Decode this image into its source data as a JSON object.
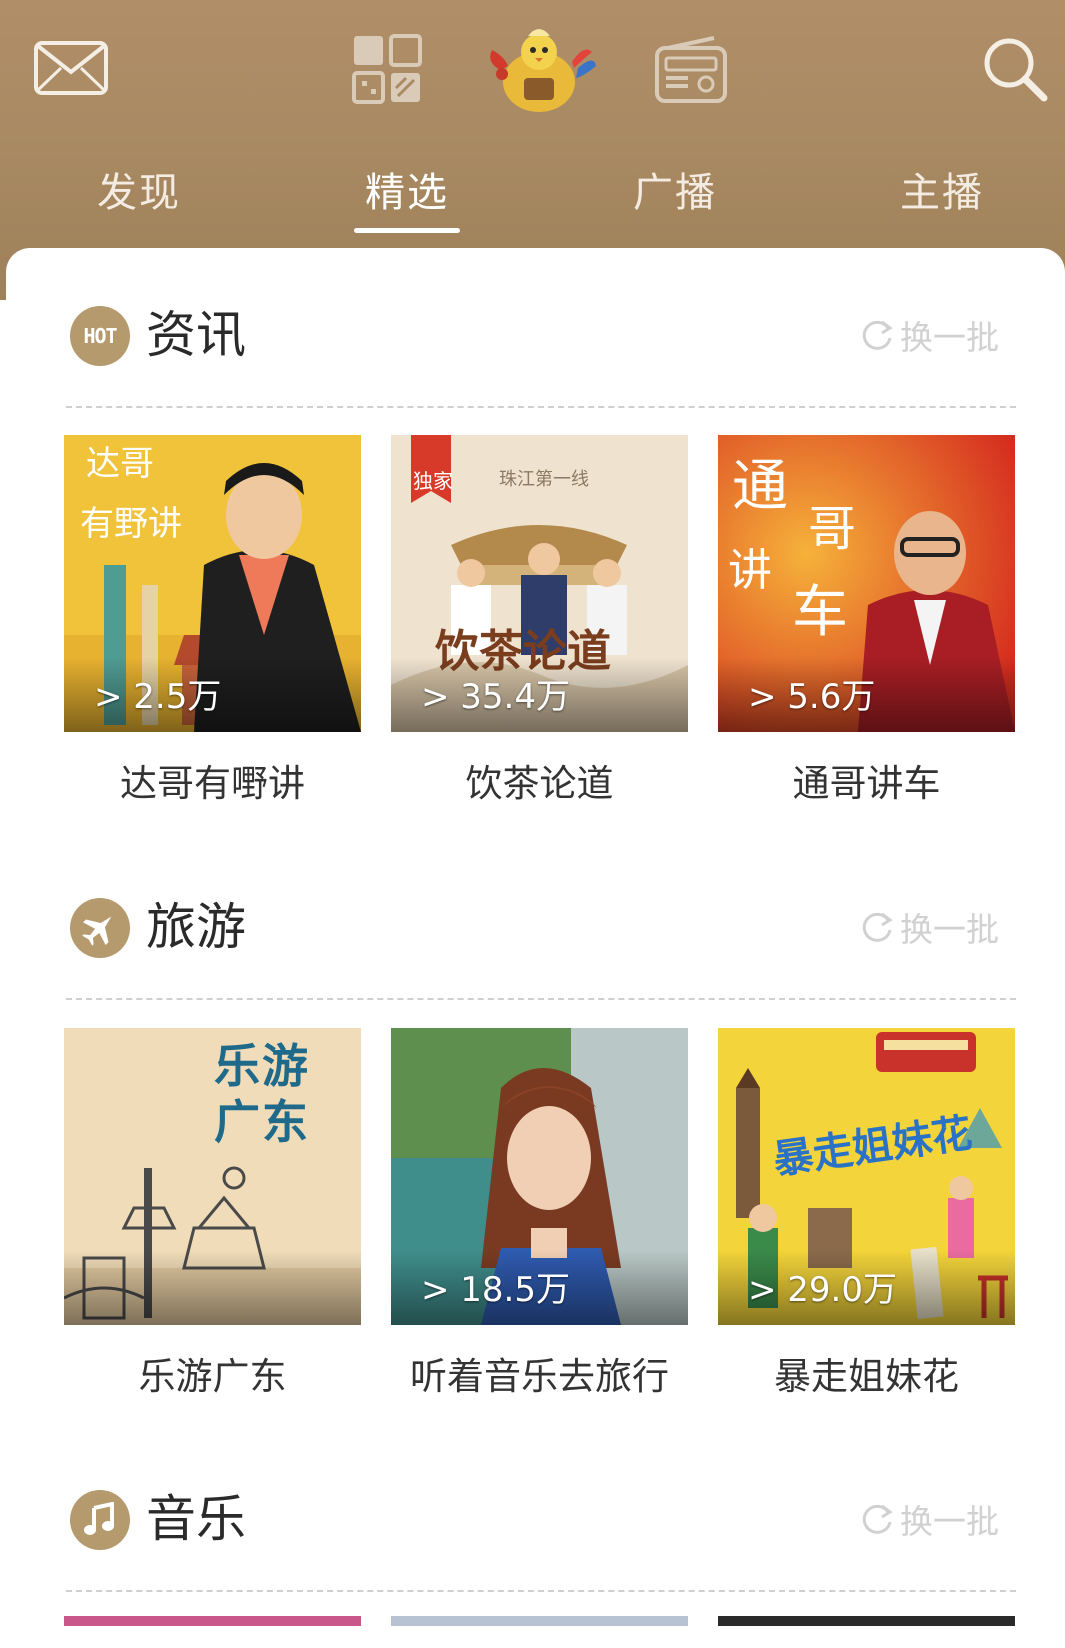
{
  "header": {
    "tabs": [
      {
        "label": "发现"
      },
      {
        "label": "精选"
      },
      {
        "label": "广播"
      },
      {
        "label": "主播"
      }
    ],
    "active_tab": "精选"
  },
  "sections": [
    {
      "title": "资讯",
      "icon": "hot-icon",
      "icon_text": "HOT",
      "refresh_label": "换一批",
      "cards": [
        {
          "title": "达哥有嘢讲",
          "count": "> 2.5万",
          "cover_text": "达哥有野讲"
        },
        {
          "title": "饮茶论道",
          "count": "> 35.4万",
          "cover_text": "饮茶论道",
          "badge": "独家",
          "subtitle": "珠江第一线"
        },
        {
          "title": "通哥讲车",
          "count": "> 5.6万",
          "cover_text": "通哥讲车"
        }
      ]
    },
    {
      "title": "旅游",
      "icon": "airplane-icon",
      "refresh_label": "换一批",
      "cards": [
        {
          "title": "乐游广东",
          "count": "",
          "cover_text": "乐游广东"
        },
        {
          "title": "听着音乐去旅行",
          "count": "> 18.5万"
        },
        {
          "title": "暴走姐妹花",
          "count": "> 29.0万",
          "cover_text": "暴走姐妹花"
        }
      ]
    },
    {
      "title": "音乐",
      "icon": "music-note-icon",
      "refresh_label": "换一批",
      "cards": []
    }
  ],
  "colors": {
    "header_brown": "#a98a63",
    "section_icon": "#b49a6c",
    "refresh_gray": "#d1d1d1"
  }
}
